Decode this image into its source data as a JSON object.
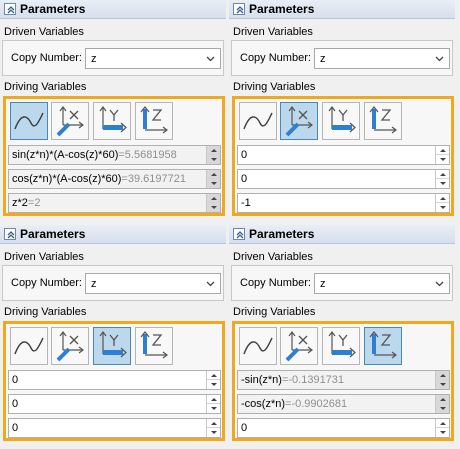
{
  "panels": [
    {
      "header": "Parameters",
      "driven_label": "Driven Variables",
      "copy_label": "Copy Number:",
      "copy_value": "z",
      "driving_label": "Driving Variables",
      "active_icon": 0,
      "fields": [
        {
          "expr": "sin(z*n)*(A-cos(z)*60)",
          "result": "=5.5681958",
          "disabled": true
        },
        {
          "expr": "cos(z*n)*(A-cos(z)*60)",
          "result": "=39.6197721",
          "disabled": true
        },
        {
          "expr": "z*2",
          "result": "=2",
          "disabled": true
        }
      ]
    },
    {
      "header": "Parameters",
      "driven_label": "Driven Variables",
      "copy_label": "Copy Number:",
      "copy_value": "z",
      "driving_label": "Driving Variables",
      "active_icon": 1,
      "fields": [
        {
          "expr": "0",
          "result": "",
          "disabled": false
        },
        {
          "expr": "0",
          "result": "",
          "disabled": false
        },
        {
          "expr": "-1",
          "result": "",
          "disabled": false
        }
      ]
    },
    {
      "header": "Parameters",
      "driven_label": "Driven Variables",
      "copy_label": "Copy Number:",
      "copy_value": "z",
      "driving_label": "Driving Variables",
      "active_icon": 2,
      "fields": [
        {
          "expr": "0",
          "result": "",
          "disabled": false
        },
        {
          "expr": "0",
          "result": "",
          "disabled": false
        },
        {
          "expr": "0",
          "result": "",
          "disabled": false
        }
      ]
    },
    {
      "header": "Parameters",
      "driven_label": "Driven Variables",
      "copy_label": "Copy Number:",
      "copy_value": "z",
      "driving_label": "Driving Variables",
      "active_icon": 3,
      "fields": [
        {
          "expr": "-sin(z*n)",
          "result": "=-0.1391731",
          "disabled": true
        },
        {
          "expr": "-cos(z*n)",
          "result": "=-0.9902681",
          "disabled": true
        },
        {
          "expr": "0",
          "result": "",
          "disabled": false
        }
      ]
    }
  ],
  "icons": [
    "curve-icon",
    "x-axis-icon",
    "y-axis-icon",
    "z-axis-icon"
  ],
  "accent_color": "#f0a81c",
  "active_icon_color": "#bcd8ec"
}
